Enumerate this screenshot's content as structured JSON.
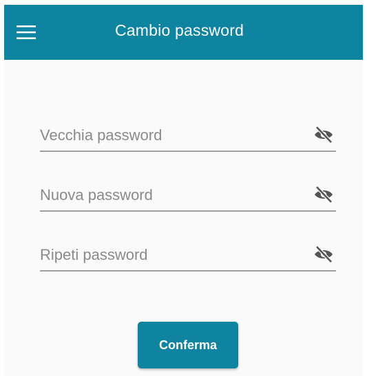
{
  "appbar": {
    "title": "Cambio password",
    "menu_icon": "hamburger-menu-icon",
    "background_color": "#0f84a0"
  },
  "form": {
    "fields": [
      {
        "placeholder": "Vecchia password",
        "value": "",
        "toggle_icon": "eye-off-icon"
      },
      {
        "placeholder": "Nuova password",
        "value": "",
        "toggle_icon": "eye-off-icon"
      },
      {
        "placeholder": "Ripeti password",
        "value": "",
        "toggle_icon": "eye-off-icon"
      }
    ]
  },
  "actions": {
    "confirm_label": "Conferma",
    "confirm_color": "#0f84a0"
  }
}
